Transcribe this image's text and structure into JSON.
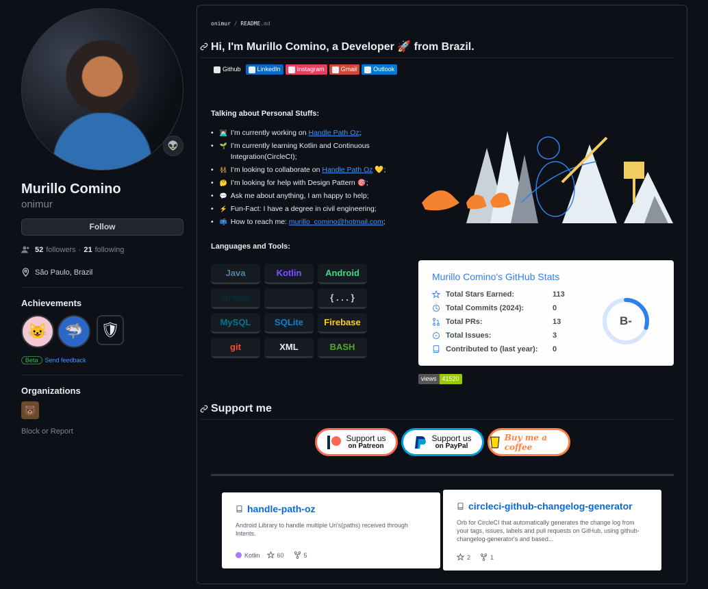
{
  "profile": {
    "name": "Murillo Comino",
    "login": "onimur",
    "follow_label": "Follow",
    "followers_count": "52",
    "followers_label": "followers",
    "following_count": "21",
    "following_label": "following",
    "location": "São Paulo, Brazil"
  },
  "achievements": {
    "title": "Achievements",
    "beta_label": "Beta",
    "feedback_label": "Send feedback"
  },
  "organizations": {
    "title": "Organizations",
    "block_label": "Block or Report"
  },
  "readme": {
    "crumb_user": "onimur",
    "crumb_sep": "/",
    "crumb_file": "README",
    "crumb_ext": ".md",
    "heading": "Hi, I'm Murillo Comino, a Developer 🚀 from Brazil.",
    "social": [
      {
        "label": "Github",
        "icon": "github-icon",
        "color": "#0d1117"
      },
      {
        "label": "LinkedIn",
        "icon": "linkedin-icon",
        "color": "#0a66c2"
      },
      {
        "label": "Instagram",
        "icon": "instagram-icon",
        "color": "#e4405f"
      },
      {
        "label": "Gmail",
        "icon": "gmail-icon",
        "color": "#d14836"
      },
      {
        "label": "Outlook",
        "icon": "outlook-icon",
        "color": "#0078d4"
      }
    ],
    "personal_title": "Talking about Personal Stuffs:",
    "bullets": [
      {
        "emoji": "👨🏻‍💻",
        "text": "I’m currently working on ",
        "link": "Handle Path Oz",
        "after": ";"
      },
      {
        "emoji": "🌱",
        "text": "I’m currently learning Kotlin and Continuous Integration(CircleCI);",
        "link": "",
        "after": ""
      },
      {
        "emoji": "👯‍♀️",
        "text": "I’m looking to collaborate on ",
        "link": "Handle Path Oz",
        "after": " 💛;"
      },
      {
        "emoji": "🤔",
        "text": "I’m looking for help with Design Pattern 🎯;",
        "link": "",
        "after": ""
      },
      {
        "emoji": "💬",
        "text": "Ask me about anything, I am happy to help;",
        "link": "",
        "after": ""
      },
      {
        "emoji": "⚡",
        "text": "Fun-Fact: I have a degree in civil engineering;",
        "link": "",
        "after": ""
      },
      {
        "emoji": "📫",
        "text": "How to reach me: ",
        "link": "murillo_comino@hotmail.com",
        "after": ";"
      }
    ],
    "languages_title": "Languages and Tools:",
    "tools": [
      {
        "label": "Java",
        "color": "#5382a1"
      },
      {
        "label": "Kotlin",
        "color": "#7f52ff"
      },
      {
        "label": "Android",
        "color": "#3ddc84"
      },
      {
        "label": "Gradle",
        "color": "#02303a"
      },
      {
        "label": "",
        "color": "#30363d"
      },
      {
        "label": "{ . . . }",
        "color": "#c9d1d9"
      },
      {
        "label": "MySQL",
        "color": "#00758f"
      },
      {
        "label": "SQLite",
        "color": "#0f80cc"
      },
      {
        "label": "Firebase",
        "color": "#ffca28"
      },
      {
        "label": "git",
        "color": "#f05032"
      },
      {
        "label": "XML",
        "color": "#e6edf3"
      },
      {
        "label": "BASH",
        "color": "#4eaa25"
      }
    ],
    "stats": {
      "title": "Murillo Comino's GitHub Stats",
      "rows": [
        {
          "label": "Total Stars Earned:",
          "value": "113",
          "icon": "star-icon"
        },
        {
          "label": "Total Commits (2024):",
          "value": "0",
          "icon": "history-icon"
        },
        {
          "label": "Total PRs:",
          "value": "13",
          "icon": "pull-request-icon"
        },
        {
          "label": "Total Issues:",
          "value": "3",
          "icon": "issue-icon"
        },
        {
          "label": "Contributed to (last year):",
          "value": "0",
          "icon": "repo-icon"
        }
      ],
      "rank": "B-",
      "rank_progress": 0.3,
      "accent": "#2f80ed"
    },
    "views_label": "views",
    "views_value": "41520",
    "support_title": "Support me",
    "support": [
      {
        "top": "Support us",
        "bottom": "on Patreon",
        "color": "#f96854"
      },
      {
        "top": "Support us",
        "bottom": "on PayPal",
        "color": "#009cde"
      },
      {
        "top": "Buy me a coffee",
        "bottom": "",
        "color": "#ff813f"
      }
    ],
    "repos": [
      {
        "name": "handle-path-oz",
        "desc": "Android Library to handle multiple Uri's(paths) received through Intents.",
        "language": "Kotlin",
        "stars": "60",
        "forks": "5"
      },
      {
        "name": "circleci-github-changelog-generator",
        "desc": "Orb for CircleCI that automatically generates the change log from your tags, issues, labels and pull requests on GitHub, using github-changelog-generator's and based...",
        "language": "",
        "stars": "2",
        "forks": "1"
      }
    ]
  }
}
